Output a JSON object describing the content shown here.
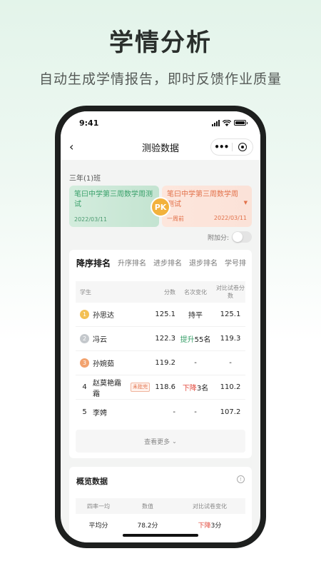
{
  "hero": {
    "title": "学情分析",
    "subtitle": "自动生成学情报告，即时反馈作业质量"
  },
  "status_bar": {
    "time": "9:41"
  },
  "nav": {
    "title": "测验数据"
  },
  "class_name": "三年(1)班",
  "exam_left": {
    "name": "笔曰中学第三周数学周测试",
    "date": "2022/03/11"
  },
  "exam_right": {
    "name": "笔曰中学第三周数学周测试",
    "period": "一周前",
    "date": "2022/03/11"
  },
  "pk_label": "PK",
  "bonus_label": "附加分:",
  "tabs": [
    "降序排名",
    "升序排名",
    "进步排名",
    "退步排名",
    "学号排"
  ],
  "table": {
    "headers": {
      "student": "学生",
      "score": "分数",
      "change": "名次变化",
      "compare": "对比试卷分数"
    },
    "rows": [
      {
        "rank": "1",
        "name": "孙思达",
        "score": "125.1",
        "change_prefix": "持平",
        "change_value": "",
        "compare": "125.1"
      },
      {
        "rank": "2",
        "name": "冯云",
        "score": "122.3",
        "change_prefix": "提升",
        "change_value": "55名",
        "compare": "119.3"
      },
      {
        "rank": "3",
        "name": "孙婉茹",
        "score": "119.2",
        "change_prefix": "-",
        "change_value": "",
        "compare": "-"
      },
      {
        "rank": "4",
        "name": "赵莫艳霜霜",
        "tag": "未批完",
        "score": "118.6",
        "change_prefix": "下降",
        "change_value": "3名",
        "compare": "110.2"
      },
      {
        "rank": "5",
        "name": "李娉",
        "score": "-",
        "change_prefix": "-",
        "change_value": "",
        "compare": "107.2"
      }
    ]
  },
  "more_button": "查看更多",
  "overview": {
    "title": "概览数据",
    "headers": [
      "四率一均",
      "数值",
      "对比试卷变化"
    ],
    "row": {
      "metric": "平均分",
      "value": "78.2分",
      "change_prefix": "下降",
      "change_value": "3分"
    }
  },
  "colors": {
    "accent_green": "#3aa16b",
    "accent_orange": "#e2714a",
    "down_red": "#e24a3d",
    "pk_yellow": "#f2b23c"
  }
}
